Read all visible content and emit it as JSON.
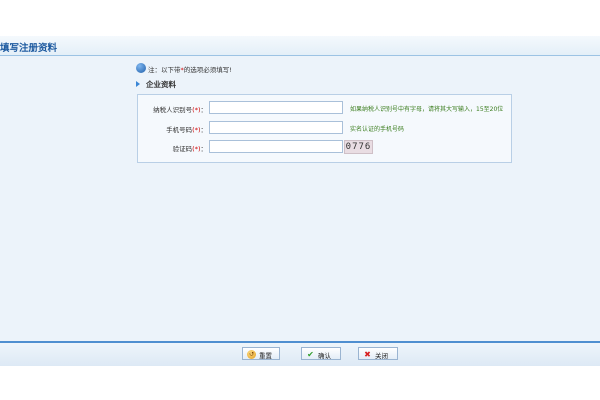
{
  "header": {
    "title": "填写注册资料"
  },
  "notice": {
    "prefix": "注：以下带",
    "asterisk": "*",
    "suffix": "的选项必须填写!"
  },
  "section": {
    "title": "企业资料"
  },
  "form": {
    "fields": [
      {
        "label": "纳税人识别号",
        "required": "(*)",
        "colon": "：",
        "value": "",
        "hint": "如果纳税人识别号中有字母，请将其大写输入，15至20位"
      },
      {
        "label": "手机号码",
        "required": "(*)",
        "colon": "：",
        "value": "",
        "hint": "实名认证的手机号码"
      },
      {
        "label": "验证码",
        "required": "(*)",
        "colon": "：",
        "value": "",
        "captcha": "0776"
      }
    ]
  },
  "buttons": {
    "reset": "重置",
    "confirm": "确认",
    "close": "关闭"
  },
  "colors": {
    "accent": "#1d5aa0",
    "required": "#d00000",
    "hint": "#3b7d1e",
    "panel": "#ecf3fa"
  }
}
